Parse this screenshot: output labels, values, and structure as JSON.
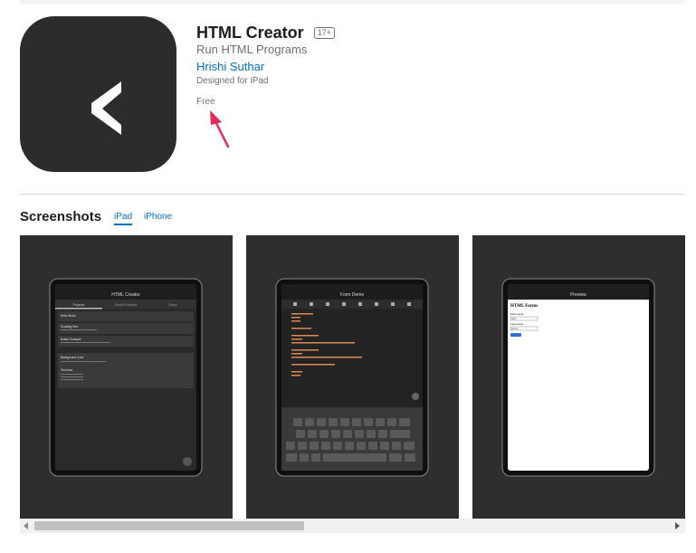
{
  "app": {
    "title": "HTML Creator",
    "age_rating": "17+",
    "subtitle": "Run HTML Programs",
    "developer": "Hrishi Suthar",
    "designed_for": "Designed for iPad",
    "price": "Free",
    "icon_glyph": "<"
  },
  "screenshots": {
    "heading": "Screenshots",
    "tabs": [
      {
        "label": "iPad",
        "selected": true
      },
      {
        "label": "iPhone",
        "selected": false
      }
    ],
    "shot1": {
      "nav_title": "HTML Creator",
      "tabs": [
        "Projects",
        "Saved Products",
        "Demo"
      ],
      "items": [
        "Hello World",
        "Scrolling Text",
        "Button Example",
        "Background Color",
        "Text Area"
      ]
    },
    "shot2": {
      "nav_title": "Form Demo"
    },
    "shot3": {
      "nav_title": "Preview",
      "heading": "HTML Forms",
      "labels": [
        "First name:",
        "Last name:"
      ],
      "values": [
        "John",
        "Deuce"
      ]
    }
  },
  "colors": {
    "link_blue": "#0070c9",
    "annotation_arrow": "#e8275a",
    "icon_background": "#2c2c2c"
  }
}
